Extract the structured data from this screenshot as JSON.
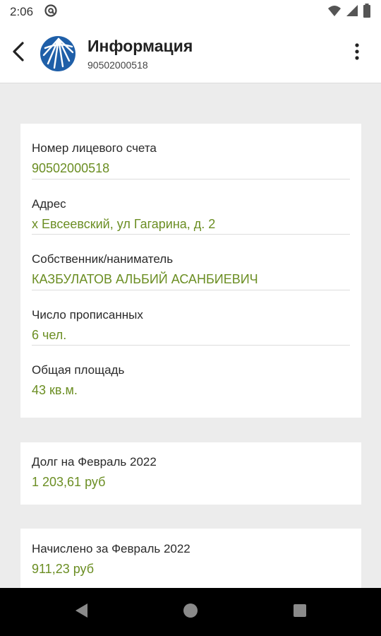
{
  "status_bar": {
    "time": "2:06"
  },
  "app_bar": {
    "title": "Информация",
    "subtitle": "90502000518"
  },
  "account_card": {
    "fields": [
      {
        "label": "Номер лицевого счета",
        "value": "90502000518"
      },
      {
        "label": "Адрес",
        "value": "х Евсеевский, ул Гагарина, д. 2"
      },
      {
        "label": "Собственник/наниматель",
        "value": "КАЗБУЛАТОВ АЛЬБИЙ АСАНБИЕВИЧ"
      },
      {
        "label": "Число прописанных",
        "value": "6 чел."
      },
      {
        "label": "Общая площадь",
        "value": "43 кв.м."
      }
    ]
  },
  "debt_card": {
    "label": "Долг на Февраль 2022",
    "value": "1 203,61 руб"
  },
  "charged_card": {
    "label": "Начислено за Февраль 2022",
    "value": "911,23 руб"
  },
  "colors": {
    "accent_value": "#6b8e23",
    "logo_blue": "#1f5fa8",
    "background": "#ececec"
  },
  "icons": [
    "at-sign-icon",
    "wifi-icon",
    "signal-icon",
    "battery-icon",
    "back-arrow-icon",
    "company-logo",
    "more-vert-icon",
    "nav-back-icon",
    "nav-home-icon",
    "nav-recents-icon"
  ]
}
